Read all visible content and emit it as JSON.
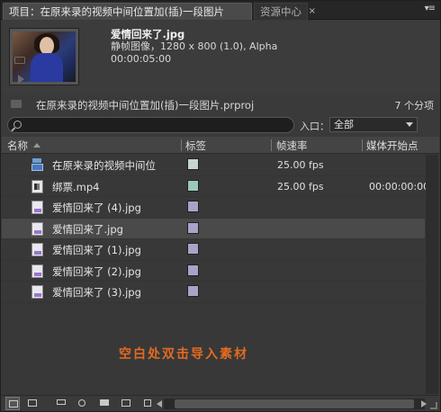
{
  "tabs": [
    {
      "label": "项目：在原来录的视频中间位置加(插)一段图片",
      "active": true
    },
    {
      "label": "资源中心",
      "active": false
    }
  ],
  "tab_close_glyph": "×",
  "panel_menu_glyph": "▾≡",
  "preview": {
    "clip_name": "爱情回来了.jpg",
    "clip_info": "静帧图像，1280 x 800 (1.0), Alpha",
    "clip_duration": "00:00:05:00"
  },
  "project": {
    "file_name": "在原来录的视频中间位置加(插)一段图片.prproj",
    "item_count": "7 个分项"
  },
  "search": {
    "value": "",
    "placeholder": ""
  },
  "entry": {
    "label": "入口：",
    "selected": "全部"
  },
  "columns": {
    "name": "名称",
    "label": "标签",
    "fps": "帧速率",
    "media_start": "媒体开始点"
  },
  "rows": [
    {
      "icon": "sequence-icon",
      "name": "在原来录的视频中间位",
      "swatch": "#c8d4d4",
      "fps": "25.00 fps",
      "start": ""
    },
    {
      "icon": "audio-video-icon",
      "name": "绑票.mp4",
      "swatch": "#9cc8bc",
      "fps": "25.00 fps",
      "start": "00:00:00:00"
    },
    {
      "icon": "image-file-icon",
      "name": "爱情回来了 (4).jpg",
      "swatch": "#a8a4c8",
      "fps": "",
      "start": ""
    },
    {
      "icon": "image-file-icon",
      "name": "爱情回来了.jpg",
      "swatch": "#a8a4c8",
      "fps": "",
      "start": "",
      "selected": true
    },
    {
      "icon": "image-file-icon",
      "name": "爱情回来了 (1).jpg",
      "swatch": "#a8a4c8",
      "fps": "",
      "start": ""
    },
    {
      "icon": "image-file-icon",
      "name": "爱情回来了 (2).jpg",
      "swatch": "#a8a4c8",
      "fps": "",
      "start": ""
    },
    {
      "icon": "image-file-icon",
      "name": "爱情回来了 (3).jpg",
      "swatch": "#a8a4c8",
      "fps": "",
      "start": ""
    }
  ],
  "hint": "空白处双击导入素材",
  "colors": {
    "hint": "#e36b22",
    "panel_bg": "#383838",
    "selected_row": "#4a4a4a"
  },
  "bottom_icons": [
    "list-view-icon",
    "icon-view-icon",
    "automate-to-sequence-icon",
    "find-icon",
    "new-bin-icon",
    "new-item-icon",
    "delete-icon"
  ]
}
